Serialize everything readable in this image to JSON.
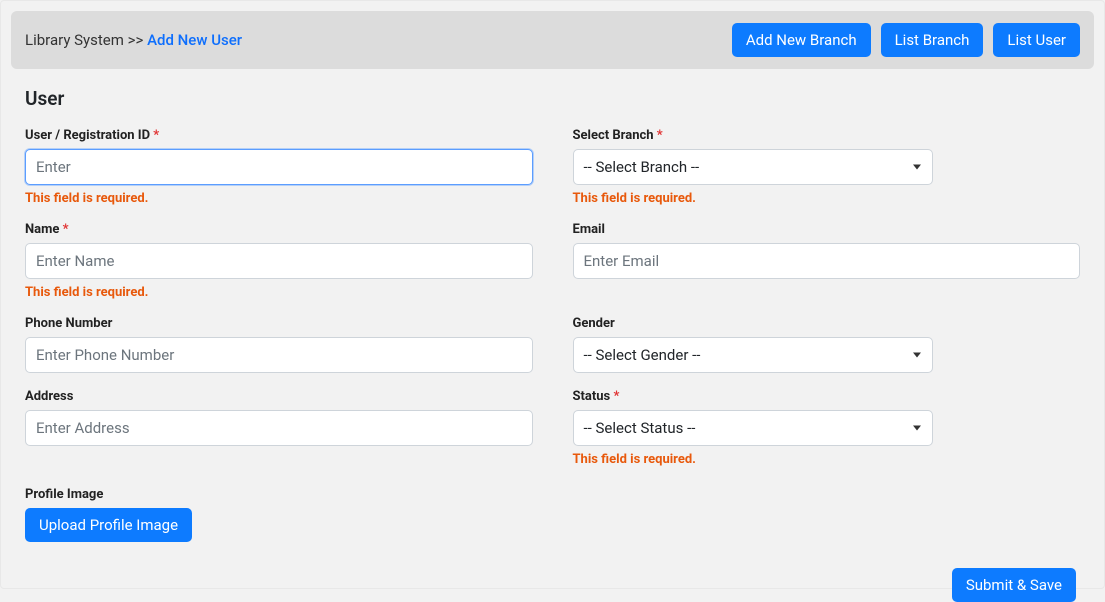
{
  "breadcrumb": {
    "root": "Library System",
    "separator": ">>",
    "current": "Add New User"
  },
  "header_buttons": {
    "add_branch": "Add New Branch",
    "list_branch": "List Branch",
    "list_user": "List User"
  },
  "section_title": "User",
  "form": {
    "registration": {
      "label": "User / Registration ID",
      "placeholder": "Enter",
      "error": "This field is required."
    },
    "branch": {
      "label": "Select Branch",
      "selected": "-- Select Branch --",
      "error": "This field is required."
    },
    "name": {
      "label": "Name",
      "placeholder": "Enter Name",
      "error": "This field is required."
    },
    "email": {
      "label": "Email",
      "placeholder": "Enter Email"
    },
    "phone": {
      "label": "Phone Number",
      "placeholder": "Enter Phone Number"
    },
    "gender": {
      "label": "Gender",
      "selected": "-- Select Gender --"
    },
    "address": {
      "label": "Address",
      "placeholder": "Enter Address"
    },
    "status": {
      "label": "Status",
      "selected": "-- Select Status --",
      "error": "This field is required."
    },
    "profile_image": {
      "label": "Profile Image",
      "button": "Upload Profile Image"
    },
    "submit": "Submit & Save",
    "required_mark": "*"
  }
}
